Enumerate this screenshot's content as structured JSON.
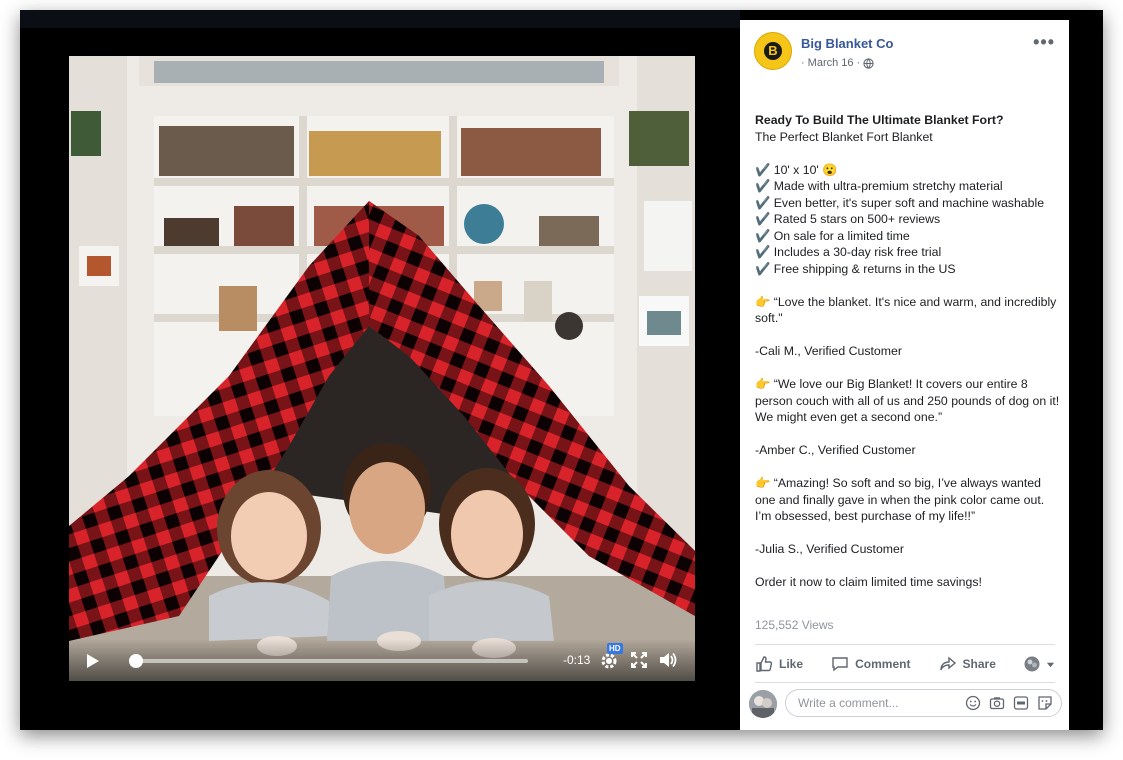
{
  "video": {
    "time_remaining": "-0:13",
    "hd_badge": "HD",
    "progress_fraction": 0.01
  },
  "post": {
    "page_name": "Big Blanket Co",
    "avatar_letter": "B",
    "date": "March 16",
    "body": {
      "title": "Ready To Build The Ultimate Blanket Fort?",
      "subtitle": "The Perfect Blanket Fort Blanket",
      "features": [
        "10' x 10' 😮",
        "Made with ultra-premium stretchy material",
        "Even better, it's super soft and machine washable",
        "Rated 5 stars on 500+ reviews",
        "On sale for a limited time",
        "Includes a 30-day risk free trial",
        "Free shipping & returns in the US"
      ],
      "review1_quote": "“Love the blanket. It's nice and warm, and incredibly soft.\"",
      "review1_author": "-Cali M., Verified Customer",
      "review2_quote": "“We love our Big Blanket! It covers our entire 8 person couch with all of us and 250 pounds of dog on it! We might even get a second one.”",
      "review2_author": "-Amber C., Verified Customer",
      "review3_quote": "“Amazing! So soft and so big, I’ve always wanted one and finally gave in when the pink color came out. I’m obsessed, best purchase of my life!!”",
      "review3_author": "-Julia S., Verified Customer",
      "cta": "Order it now to claim limited time savings!"
    },
    "views": "125,552 Views",
    "actions": {
      "like": "Like",
      "comment": "Comment",
      "share": "Share"
    },
    "comment_placeholder": "Write a comment..."
  },
  "colors": {
    "link_blue": "#385898",
    "brand_yellow": "#f5c518",
    "blanket_red": "#d8232a"
  }
}
